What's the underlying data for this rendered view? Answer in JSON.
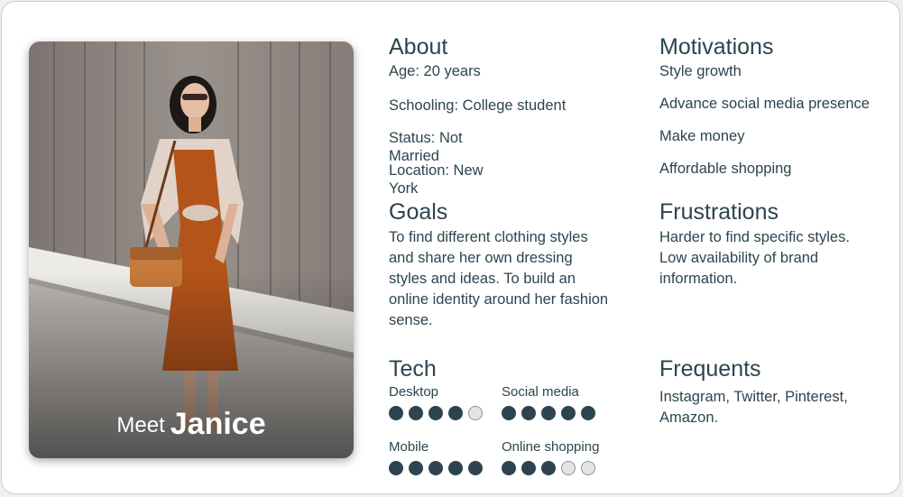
{
  "persona": {
    "meet_prefix": "Meet",
    "name": "Janice"
  },
  "about": {
    "heading": "About",
    "age": "Age: 20 years",
    "schooling": "Schooling: College student",
    "status": "Status: Not Married",
    "location": "Location: New York"
  },
  "goals": {
    "heading": "Goals",
    "text": "To find different clothing styles and share her own dressing styles and ideas. To build an online identity around her fashion sense."
  },
  "motivations": {
    "heading": "Motivations",
    "items": [
      "Style growth",
      "Advance social media presence",
      "Make money",
      "Affordable shopping"
    ]
  },
  "frustrations": {
    "heading": "Frustrations",
    "text": "Harder to find specific styles. Low availability of brand information."
  },
  "tech": {
    "heading": "Tech",
    "items": [
      {
        "label": "Desktop",
        "rating": 4,
        "max": 5
      },
      {
        "label": "Social media",
        "rating": 5,
        "max": 5
      },
      {
        "label": "Mobile",
        "rating": 5,
        "max": 5
      },
      {
        "label": "Online shopping",
        "rating": 3,
        "max": 5
      }
    ]
  },
  "frequents": {
    "heading": "Frequents",
    "text": "Instagram, Twitter, Pinterest, Amazon."
  },
  "colors": {
    "text": "#2d4450",
    "dot_filled": "#2d4450",
    "dot_empty": "#e2e4e6",
    "dress": "#b4541a"
  }
}
